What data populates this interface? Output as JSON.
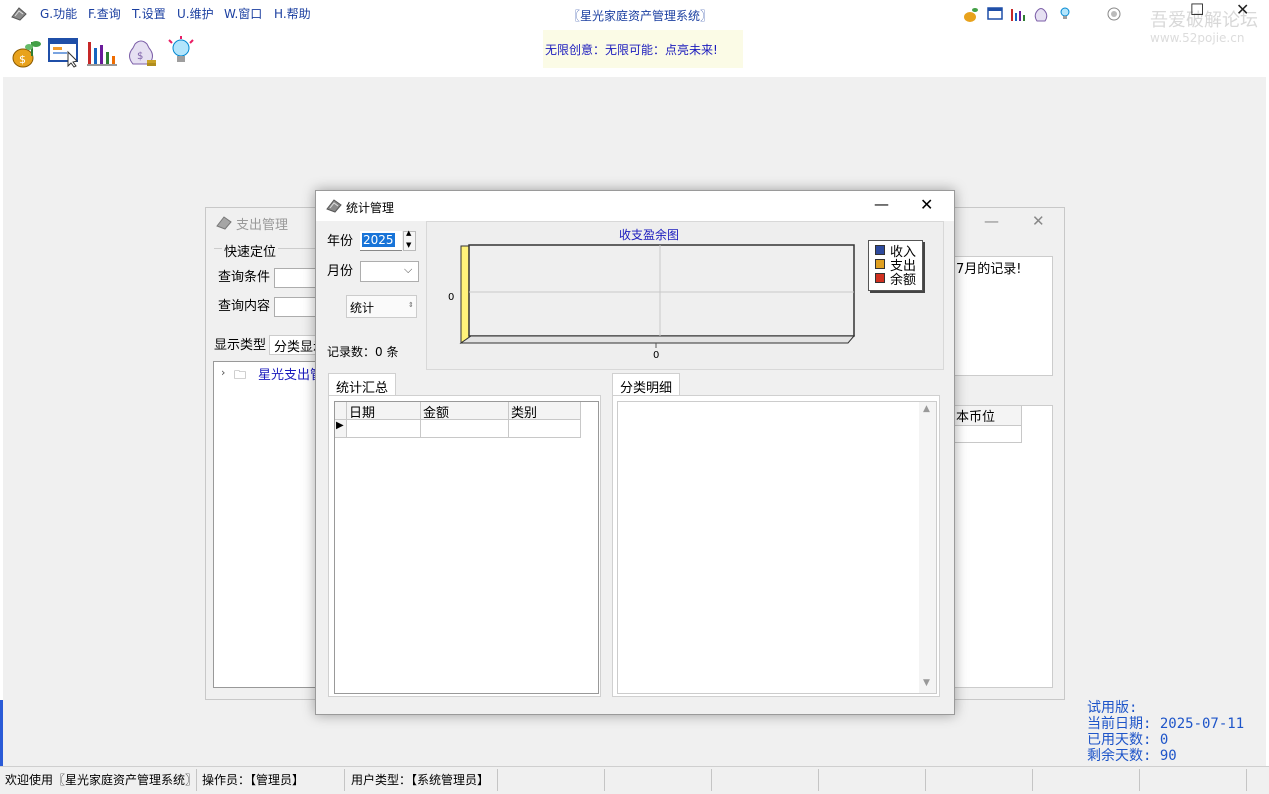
{
  "menu": [
    "G.功能",
    "F.查询",
    "T.设置",
    "U.维护",
    "W.窗口",
    "H.帮助"
  ],
  "app_title": "〖星光家庭资产管理系统〗",
  "slogan": "无限创意：无限可能：点亮未来!",
  "watermark": {
    "line1": "吾爱破解论坛",
    "line2": "www.52pojie.cn"
  },
  "toolbar_icons": [
    "money-bag-plant-icon",
    "browser-click-icon",
    "bar-chart-icon",
    "money-sack-icon",
    "lightbulb-icon"
  ],
  "small_icons": [
    "money-bag-plant-icon",
    "browser-click-icon",
    "bar-chart-icon",
    "money-sack-icon",
    "lightbulb-icon"
  ],
  "back_window": {
    "title": "支出管理",
    "group_label": "快速定位",
    "query_condition_label": "查询条件",
    "query_content_label": "查询内容",
    "display_type_label": "显示类型",
    "display_type_value": "分类显示",
    "tree_item": "星光支出管",
    "record_hint": "7月的记录!",
    "column_currency": "本币位"
  },
  "stats_window": {
    "title": "统计管理",
    "year_label": "年份",
    "year_value": "2025",
    "month_label": "月份",
    "month_value": "",
    "stat_button": "统计",
    "record_count_label": "记录数：0 条",
    "summary_tab": "统计汇总",
    "detail_tab": "分类明细",
    "grid_headers": [
      "日期",
      "金额",
      "类别"
    ]
  },
  "chart_data": {
    "type": "bar",
    "title": "收支盈余图",
    "categories": [
      "0"
    ],
    "series": [
      {
        "name": "收入",
        "values": [
          0
        ],
        "color": "#2e4a9e"
      },
      {
        "name": "支出",
        "values": [
          0
        ],
        "color": "#e0a020"
      },
      {
        "name": "余额",
        "values": [
          0
        ],
        "color": "#d03020"
      }
    ],
    "y_tick_labels": [
      "0"
    ],
    "x_tick_labels": [
      "0"
    ],
    "grid": true,
    "legend_position": "right"
  },
  "status_bar": {
    "welcome": "欢迎使用〖星光家庭资产管理系统〗",
    "operator": "操作员：【管理员】",
    "user_type": "用户类型：【系统管理员】"
  },
  "trial_info": {
    "label": "试用版:",
    "current_date": "当前日期: 2025-07-11",
    "used_days": "已用天数: 0",
    "remaining_days": "剩余天数: 90"
  },
  "colors": {
    "accent": "#1b3fa0",
    "trial_text": "#1e55c9",
    "year_highlight": "#1874d8"
  }
}
